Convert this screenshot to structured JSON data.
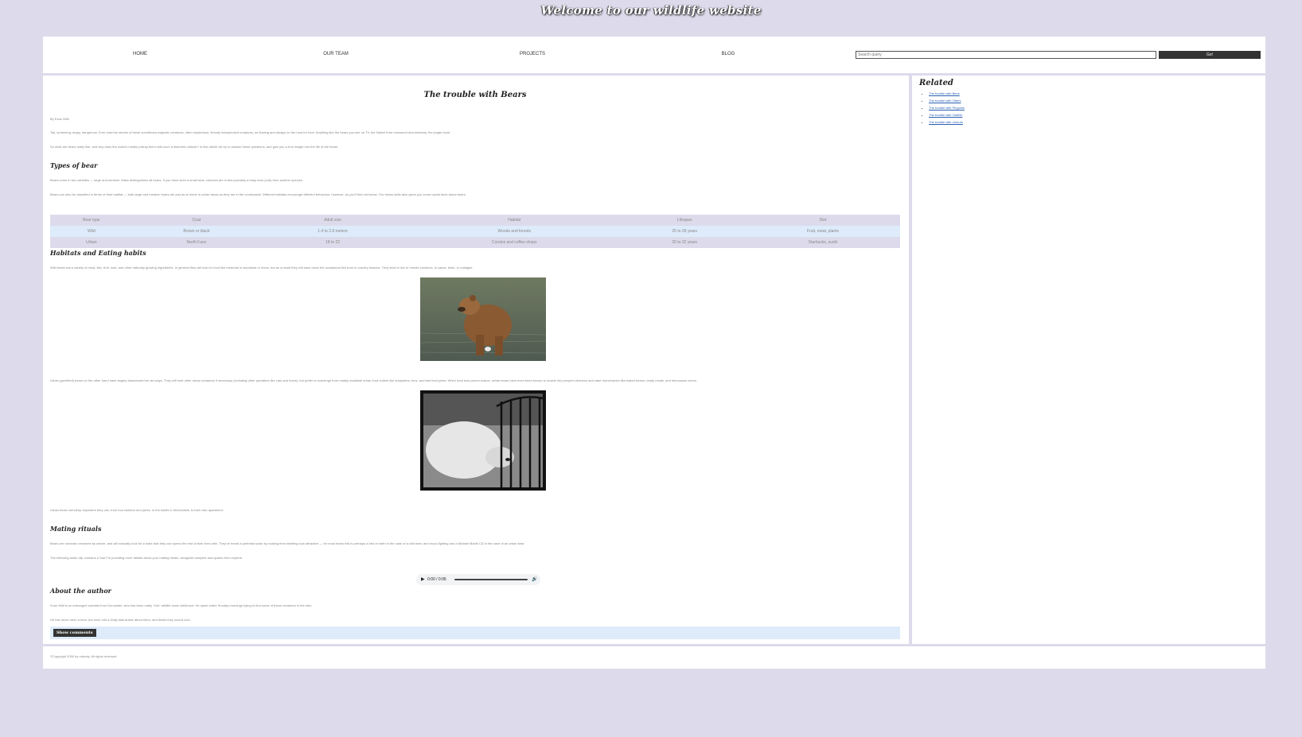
{
  "site": {
    "title": "Welcome to our wildlife website"
  },
  "nav": {
    "items": [
      "HOME",
      "OUR TEAM",
      "PROJECTS",
      "BLOG"
    ],
    "search_placeholder": "Search query",
    "search_button": "Go!"
  },
  "article": {
    "title": "The trouble with Bears",
    "byline": "By Evan Wild",
    "intro_1": "Tall, lumbering, angry, dangerous. Ever read the stories of these sometimes-majestic creatures, often mysterious, fiercely independent creatures, as flowing and always on the hunt for food. Anything like the bears you see on TV, the Native from renowned documentary, the jungle book.",
    "intro_2": "So what are bears really like, and why does the world's media portray them with such a distorted outlook? In this article we try to answer these questions, and give you a true insight into the life of the beast.",
    "types_heading": "Types of bear",
    "types_1": "Bears come in two varieties — large and medium. Mass distinguishes all bears. If you have seen a small bear, chances are in fact probably a baby bear (cub) from another species.",
    "types_2": "Bears can also be classified in terms of their habitat — both large and medium bears are just as at home in urban areas as they are in the countryside. Different habitats encourage different behaviour, however, as you'll find out below. The below table also gives you some useful facts about bears.",
    "table": {
      "headers": [
        "Bear type",
        "Coat",
        "Adult size",
        "Habitat",
        "Lifespan",
        "Diet"
      ],
      "rows": [
        [
          "Wild",
          "Brown or black",
          "1.4 to 2.8 meters",
          "Woods and forests",
          "25 to 28 years",
          "Fruit, meat, plants"
        ],
        [
          "Urban",
          "North Face",
          "18 to 22",
          "Condos and coffee shops",
          "20 to 32 years",
          "Starbucks, sushi"
        ]
      ]
    },
    "habitats_heading": "Habitats and Eating habits",
    "habitats_1": "Wild bears eat a variety of meat, fish, fruit, nuts, and other naturally growing ingredients. In general they will look for food like marmots in woodland or rivers, but as a result they will track down the occasional fish from in-country lessons. They tend to live in remote solutions, in caves, tents, or cottages.",
    "habitats_2": "Urban (genrified) bears on the other hand have largely abandoned the old ways. They will hunt other urban creatures if necessary (including other predators like cats and foxes), but prefer to scavenge from readily available urban food outlets like dumpsters, bins, and fast food joints. When food has proven scarce, urban bears have even been known to invade into people's kitchens and raise mercenaries like baked beans, ready meals, and microwave ovens.",
    "habitats_3": "Urban bears will sleep anywhere they can, from bus shelters and parks, to the toilets in McDonalds, to their own apartment.",
    "mating_heading": "Mating rituals",
    "mating_1": "Bears are romantic creatures by nature, and will naturally look for a mate that they can spend the rest of their lives with. They've heard a potential suitor by making their dwelling look attractive — for most bears this is perhaps a bed of meth in the case of a wild bear, and mood lighting and a Michael Bublé CD in the case of an urban bear.",
    "mating_2": "The following audio clip contains a Sad Fm providing more details about your mating rituals, alongside samples and quotes from experts.",
    "audio_time": "0:00 / 0:06",
    "author_heading": "About the author",
    "author_1": "Evan Wild is an estranged scientist from Doncaster, who has been really \"into\" wildlife since childhood. He spent entire Sunday mornings trying to find some of these creatures in the wild.",
    "author_2": "He has never seen a bear, but once met a Daily Mail article about them, and thinks they sound cool.",
    "comments_button": "Show comments"
  },
  "sidebar": {
    "heading": "Related",
    "links": [
      "The trouble with Bees",
      "The trouble with Otters",
      "The trouble with Pinguins",
      "The trouble with Oarfish",
      "The trouble with Lemurs"
    ]
  },
  "footer": {
    "text": "©Copyright 2050 by nobody. All rights reversed."
  },
  "colors": {
    "background": "#dddbeb",
    "accent_dark": "#333333",
    "table_alt": "#ddebfa",
    "link": "#2c5fb5"
  }
}
